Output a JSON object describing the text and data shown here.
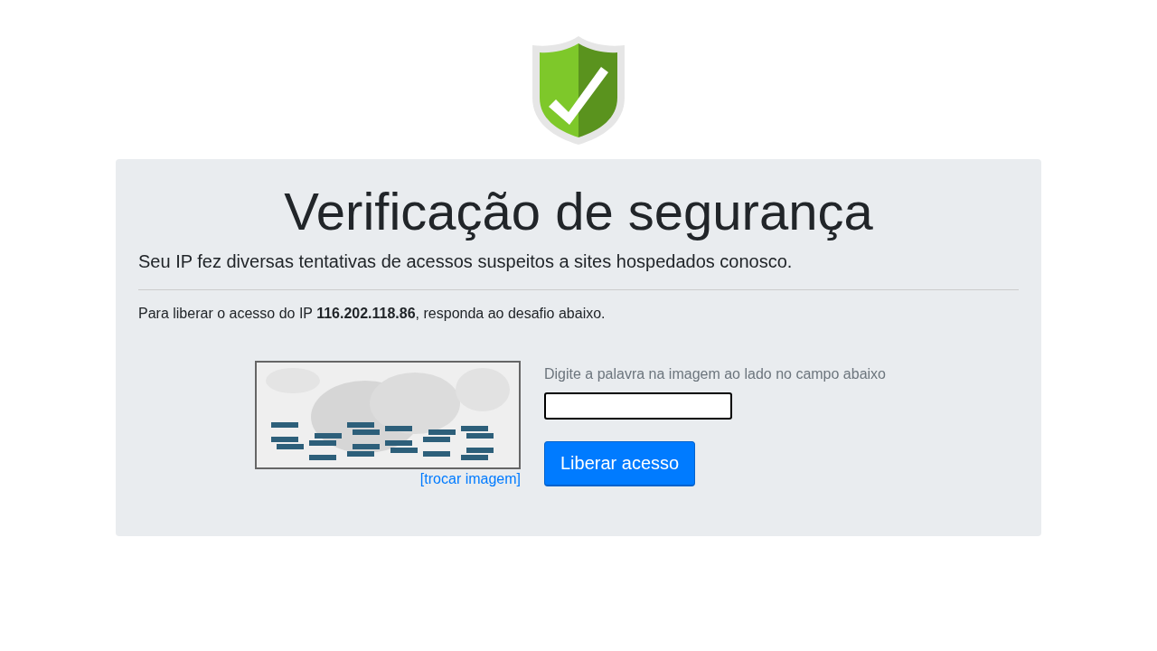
{
  "title": "Verificação de segurança",
  "lead": "Seu IP fez diversas tentativas de acessos suspeitos a sites hospedados conosco.",
  "instruction": "Para liberar o acesso do IP **116.202.118.86**, responda ao desafio abaixo.",
  "captcha": {
    "refresh_link": "[trocar imagem]"
  },
  "form": {
    "hint": "Digite a palavra na imagem ao lado no campo abaixo",
    "submit": "Liberar acesso"
  }
}
